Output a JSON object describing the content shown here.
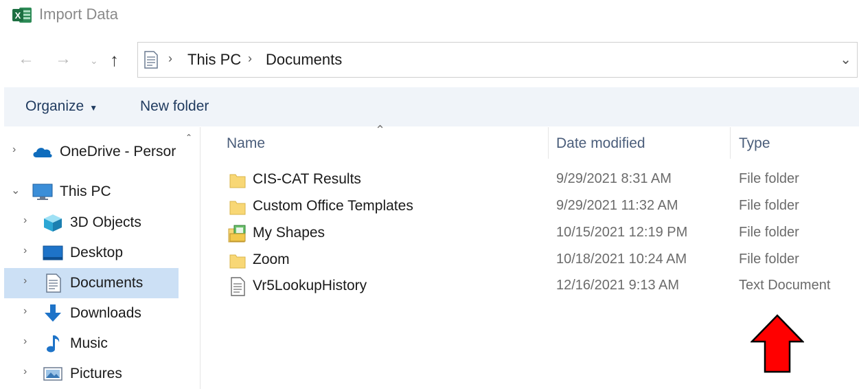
{
  "window": {
    "title": "Import Data",
    "app_icon": "excel-icon",
    "app_icon_letter": "X"
  },
  "address": {
    "breadcrumbs": [
      "This PC",
      "Documents"
    ],
    "location_icon": "documents-icon"
  },
  "toolbar": {
    "organize_label": "Organize",
    "new_folder_label": "New folder"
  },
  "nav": {
    "items": [
      {
        "label": "OneDrive - Persor",
        "icon": "cloud-icon",
        "level": 0,
        "expanded": false
      },
      {
        "label": "This PC",
        "icon": "computer-icon",
        "level": 0,
        "expanded": true
      },
      {
        "label": "3D Objects",
        "icon": "3d-objects-icon",
        "level": 1,
        "expanded": false
      },
      {
        "label": "Desktop",
        "icon": "desktop-icon",
        "level": 1,
        "expanded": false
      },
      {
        "label": "Documents",
        "icon": "documents-icon",
        "level": 1,
        "expanded": false,
        "selected": true
      },
      {
        "label": "Downloads",
        "icon": "download-icon",
        "level": 1,
        "expanded": false
      },
      {
        "label": "Music",
        "icon": "music-icon",
        "level": 1,
        "expanded": false
      },
      {
        "label": "Pictures",
        "icon": "pictures-icon",
        "level": 1,
        "expanded": false
      }
    ]
  },
  "files": {
    "columns": {
      "name": "Name",
      "date": "Date modified",
      "type": "Type"
    },
    "rows": [
      {
        "name": "CIS-CAT Results",
        "date": "9/29/2021 8:31 AM",
        "type": "File folder",
        "icon": "folder-icon"
      },
      {
        "name": "Custom Office Templates",
        "date": "9/29/2021 11:32 AM",
        "type": "File folder",
        "icon": "folder-icon"
      },
      {
        "name": "My Shapes",
        "date": "10/15/2021 12:19 PM",
        "type": "File folder",
        "icon": "shapes-folder-icon"
      },
      {
        "name": "Zoom",
        "date": "10/18/2021 10:24 AM",
        "type": "File folder",
        "icon": "folder-icon"
      },
      {
        "name": "Vr5LookupHistory",
        "date": "12/16/2021 9:13 AM",
        "type": "Text Document",
        "icon": "text-document-icon"
      }
    ]
  },
  "colors": {
    "excel_green": "#1d6f42",
    "folder_yellow": "#f8d775",
    "selection_blue": "#cce0f5",
    "annotation_red": "#ff0000"
  }
}
